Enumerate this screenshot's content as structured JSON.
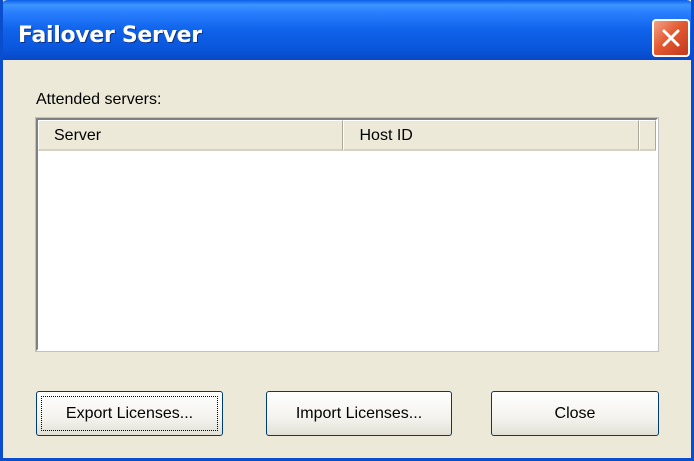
{
  "window": {
    "title": "Failover Server",
    "close_icon": "close-icon",
    "accent_color": "#0a5fe8"
  },
  "attended": {
    "label": "Attended servers:",
    "columns": [
      "Server",
      "Host ID"
    ],
    "rows": []
  },
  "buttons": {
    "export_label": "Export Licenses...",
    "import_label": "Import Licenses...",
    "close_label": "Close"
  }
}
